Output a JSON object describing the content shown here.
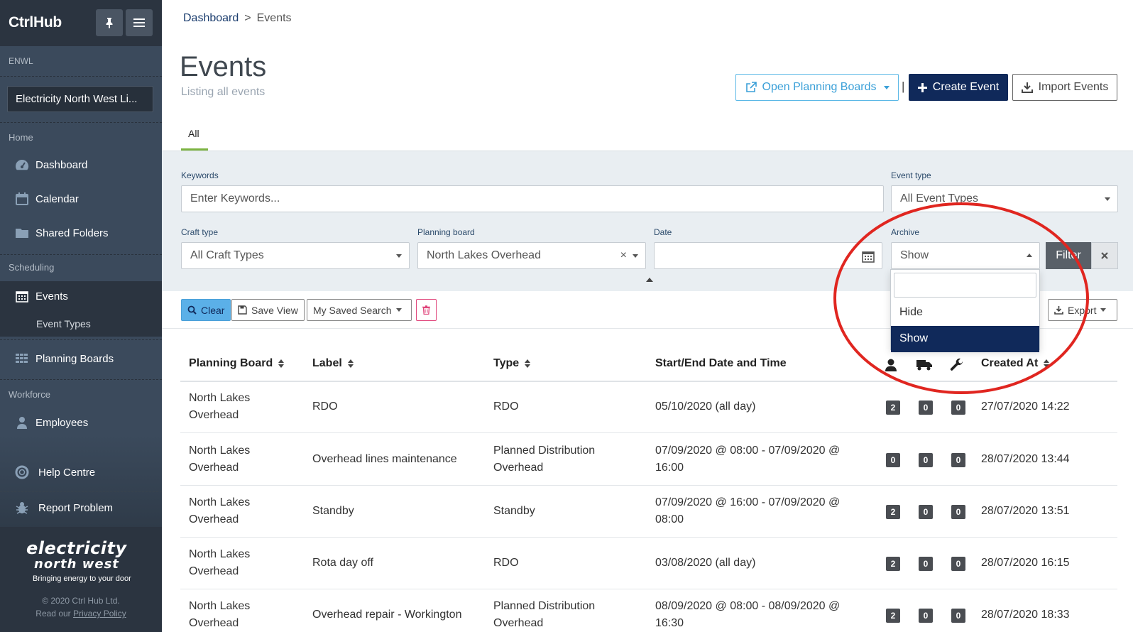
{
  "sidebar": {
    "brand": "CtrlHub",
    "org_code": "ENWL",
    "org_name": "Electricity North West Li...",
    "sections": {
      "home": "Home",
      "scheduling": "Scheduling",
      "workforce": "Workforce"
    },
    "items": {
      "dashboard": "Dashboard",
      "calendar": "Calendar",
      "shared_folders": "Shared Folders",
      "events": "Events",
      "event_types": "Event Types",
      "planning_boards": "Planning Boards",
      "employees": "Employees",
      "help_centre": "Help Centre",
      "report_problem": "Report Problem"
    },
    "logo": {
      "line1": "electricity",
      "line2": "north west",
      "tagline": "Bringing energy to your door"
    },
    "copyright": "© 2020 Ctrl Hub Ltd.",
    "privacy_prefix": "Read our",
    "privacy_link": "Privacy Policy"
  },
  "breadcrumb": {
    "parent": "Dashboard",
    "separator": ">",
    "current": "Events"
  },
  "header": {
    "title": "Events",
    "subtitle": "Listing all events",
    "open_planning_boards": "Open Planning Boards",
    "divider": "|",
    "create_event": "Create Event",
    "import_events": "Import Events"
  },
  "tabs": {
    "all": "All"
  },
  "filters": {
    "keywords_label": "Keywords",
    "keywords_placeholder": "Enter Keywords...",
    "event_type_label": "Event type",
    "event_type_value": "All Event Types",
    "craft_type_label": "Craft type",
    "craft_type_value": "All Craft Types",
    "planning_board_label": "Planning board",
    "planning_board_value": "North Lakes Overhead",
    "date_label": "Date",
    "archive_label": "Archive",
    "archive_value": "Show",
    "filter_button": "Filter",
    "archive_options": [
      "Hide",
      "Show"
    ]
  },
  "toolbar": {
    "clear": "Clear",
    "save_view": "Save View",
    "saved_search": "My Saved Search",
    "export": "Export"
  },
  "table": {
    "headers": {
      "planning_board": "Planning Board",
      "label": "Label",
      "type": "Type",
      "start_end": "Start/End Date and Time",
      "created_at": "Created At"
    },
    "rows": [
      {
        "board": [
          "North Lakes",
          "Overhead"
        ],
        "label": "RDO",
        "type": [
          "RDO",
          ""
        ],
        "date": [
          "05/10/2020 (all day)",
          ""
        ],
        "people": "2",
        "vehicles": "0",
        "tools": "0",
        "created": "27/07/2020 14:22"
      },
      {
        "board": [
          "North Lakes",
          "Overhead"
        ],
        "label": "Overhead lines maintenance",
        "type": [
          "Planned Distribution",
          "Overhead"
        ],
        "date": [
          "07/09/2020 @ 08:00 - 07/09/2020 @",
          "16:00"
        ],
        "people": "0",
        "vehicles": "0",
        "tools": "0",
        "created": "28/07/2020 13:44"
      },
      {
        "board": [
          "North Lakes",
          "Overhead"
        ],
        "label": "Standby",
        "type": [
          "Standby",
          ""
        ],
        "date": [
          "07/09/2020 @ 16:00 - 07/09/2020 @",
          "08:00"
        ],
        "people": "2",
        "vehicles": "0",
        "tools": "0",
        "created": "28/07/2020 13:51"
      },
      {
        "board": [
          "North Lakes",
          "Overhead"
        ],
        "label": "Rota day off",
        "type": [
          "RDO",
          ""
        ],
        "date": [
          "03/08/2020 (all day)",
          ""
        ],
        "people": "2",
        "vehicles": "0",
        "tools": "0",
        "created": "28/07/2020 16:15"
      },
      {
        "board": [
          "North Lakes",
          "Overhead"
        ],
        "label": "Overhead repair - Workington",
        "type": [
          "Planned Distribution",
          "Overhead"
        ],
        "date": [
          "08/09/2020 @ 08:00 - 08/09/2020 @",
          "16:30"
        ],
        "people": "2",
        "vehicles": "0",
        "tools": "0",
        "created": "28/07/2020 18:33"
      }
    ]
  },
  "colors": {
    "sidebar": "#3b4a5c",
    "sidebar_dark": "#2b3440",
    "primary": "#10295a",
    "accent_blue": "#3ba0d8",
    "annotation_red": "#e02620",
    "tab_green": "#7cb342"
  }
}
